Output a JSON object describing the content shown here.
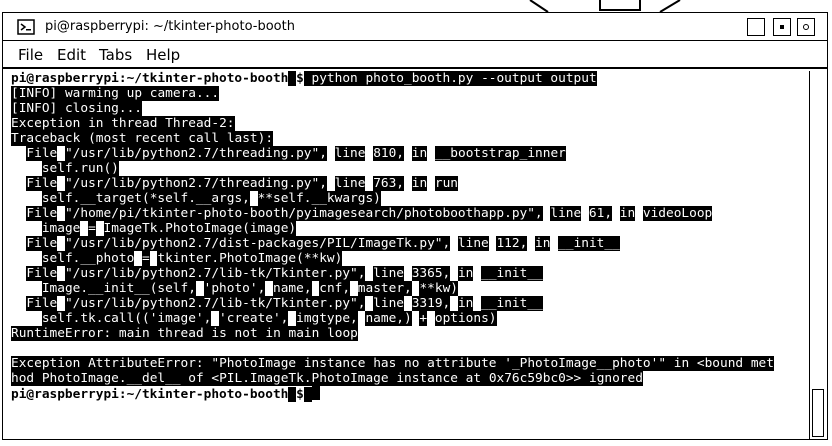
{
  "window": {
    "title": "pi@raspberrypi: ~/tkinter-photo-booth"
  },
  "menu": {
    "items": [
      "File",
      "Edit",
      "Tabs",
      "Help"
    ]
  },
  "terminal": {
    "lines": [
      {
        "text": "pi@raspberrypi:~/tkinter-photo-booth $ python photo_booth.py --output output",
        "prompt": true
      },
      {
        "text": "[INFO] warming up camera..."
      },
      {
        "text": "[INFO] closing..."
      },
      {
        "text": "Exception in thread Thread-2:"
      },
      {
        "text": "Traceback (most recent call last):"
      },
      {
        "text": "  File \"/usr/lib/python2.7/threading.py\", line 810, in __bootstrap_inner"
      },
      {
        "text": "    self.run()"
      },
      {
        "text": "  File \"/usr/lib/python2.7/threading.py\", line 763, in run"
      },
      {
        "text": "    self.__target(*self.__args, **self.__kwargs)"
      },
      {
        "text": "  File \"/home/pi/tkinter-photo-booth/pyimagesearch/photoboothapp.py\", line 61, in videoLoop"
      },
      {
        "text": "    image = ImageTk.PhotoImage(image)"
      },
      {
        "text": "  File \"/usr/lib/python2.7/dist-packages/PIL/ImageTk.py\", line 112, in __init__"
      },
      {
        "text": "    self.__photo = tkinter.PhotoImage(**kw)"
      },
      {
        "text": "  File \"/usr/lib/python2.7/lib-tk/Tkinter.py\", line 3365, in __init__"
      },
      {
        "text": "    Image.__init__(self, 'photo', name, cnf, master, **kw)"
      },
      {
        "text": "  File \"/usr/lib/python2.7/lib-tk/Tkinter.py\", line 3319, in __init__"
      },
      {
        "text": "    self.tk.call(('image', 'create', imgtype, name,) + options)"
      },
      {
        "text": "RuntimeError: main thread is not in main loop"
      },
      {
        "text": ""
      },
      {
        "text": "Exception AttributeError: \"PhotoImage instance has no attribute '_PhotoImage__photo'\" in <bound met"
      },
      {
        "text": "hod PhotoImage.__del__ of <PIL.ImageTk.PhotoImage instance at 0x76c59bc0>> ignored"
      },
      {
        "text": "pi@raspberrypi:~/tkinter-photo-booth $ ",
        "prompt": true,
        "cursor": true
      }
    ]
  }
}
